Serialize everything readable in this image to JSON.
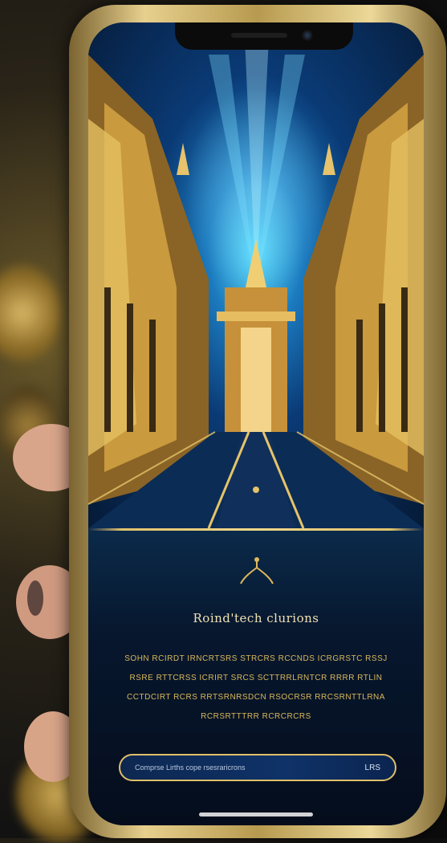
{
  "colors": {
    "gold_frame": "#e7d08e",
    "gold_text": "#d9b85c",
    "title_text": "#f0e1b4",
    "screen_bg": "#07172e",
    "button_bg": "#0f3268",
    "button_border": "#e0c069"
  },
  "screen": {
    "hero_alt": "golden-palace-street-illustration",
    "title": "Roind'tech clurions",
    "description": {
      "line1": "SOHN RCIRDT IRNCRTSRS STRCRS RCCNDS ICRGRSTC RSSJ",
      "line2": "RSRE RTTCRSS ICRIRT SRCS SCTTRRLRNTCR RRRR RTLIN",
      "line3": "CCTDCIRT RCRS RRTSRNRSDCN RSOCRSR RRCSRNTTLRNA",
      "line4": "RCRSRTTTRR RCRCRCRS"
    },
    "cta": {
      "label": "Comprse Lirths cope rsesraricrons",
      "trailing": "LRS"
    }
  },
  "icons": {
    "ornament": "gold-flourish-icon",
    "camera": "front-camera-icon"
  }
}
